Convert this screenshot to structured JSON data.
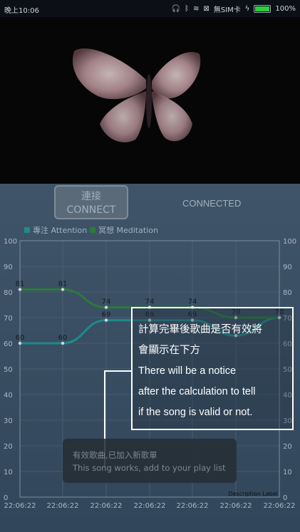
{
  "status_bar": {
    "time": "晚上10:06",
    "sim": "無SIM卡",
    "battery": "100%",
    "battery_level": 1.0
  },
  "connect_button": {
    "line1": "連接",
    "line2": "CONNECT"
  },
  "connection_status": "CONNECTED",
  "chart_data": {
    "type": "line",
    "categories": [
      "22:06:22",
      "22:06:22",
      "22:06:22",
      "22:06:22",
      "22:06:22",
      "22:06:22",
      "22:06:22"
    ],
    "series": [
      {
        "name": "專注 Attention",
        "color": "#1f8a8a",
        "values": [
          60,
          60,
          69,
          69,
          69,
          63,
          70
        ],
        "labels": [
          "60",
          "60",
          "69",
          "69",
          "69",
          "",
          "70"
        ]
      },
      {
        "name": "冥想 Meditation",
        "color": "#2c7a3c",
        "values": [
          81,
          81,
          74,
          74,
          74,
          70,
          70
        ],
        "labels": [
          "81",
          "81",
          "74",
          "74",
          "74",
          "70",
          "70"
        ]
      }
    ],
    "ylim": [
      0,
      100
    ],
    "yticks": [
      0,
      10,
      20,
      30,
      40,
      50,
      60,
      70,
      80,
      90,
      100
    ],
    "grid": true,
    "legend": "top-left",
    "description_label": "Description Label"
  },
  "notice": {
    "lines": [
      "計算完畢後歌曲是否有效將",
      "會顯示在下方",
      "There will be a notice",
      "after the calculation to tell",
      "if the song is valid or not."
    ]
  },
  "toast": {
    "line1": "有效歌曲,已加入新歌單",
    "line2": "This song works, add to your play list"
  },
  "icons": [
    "headphones-icon",
    "bluetooth-icon",
    "wifi-icon",
    "sim-icon",
    "charging-icon",
    "battery-icon"
  ]
}
